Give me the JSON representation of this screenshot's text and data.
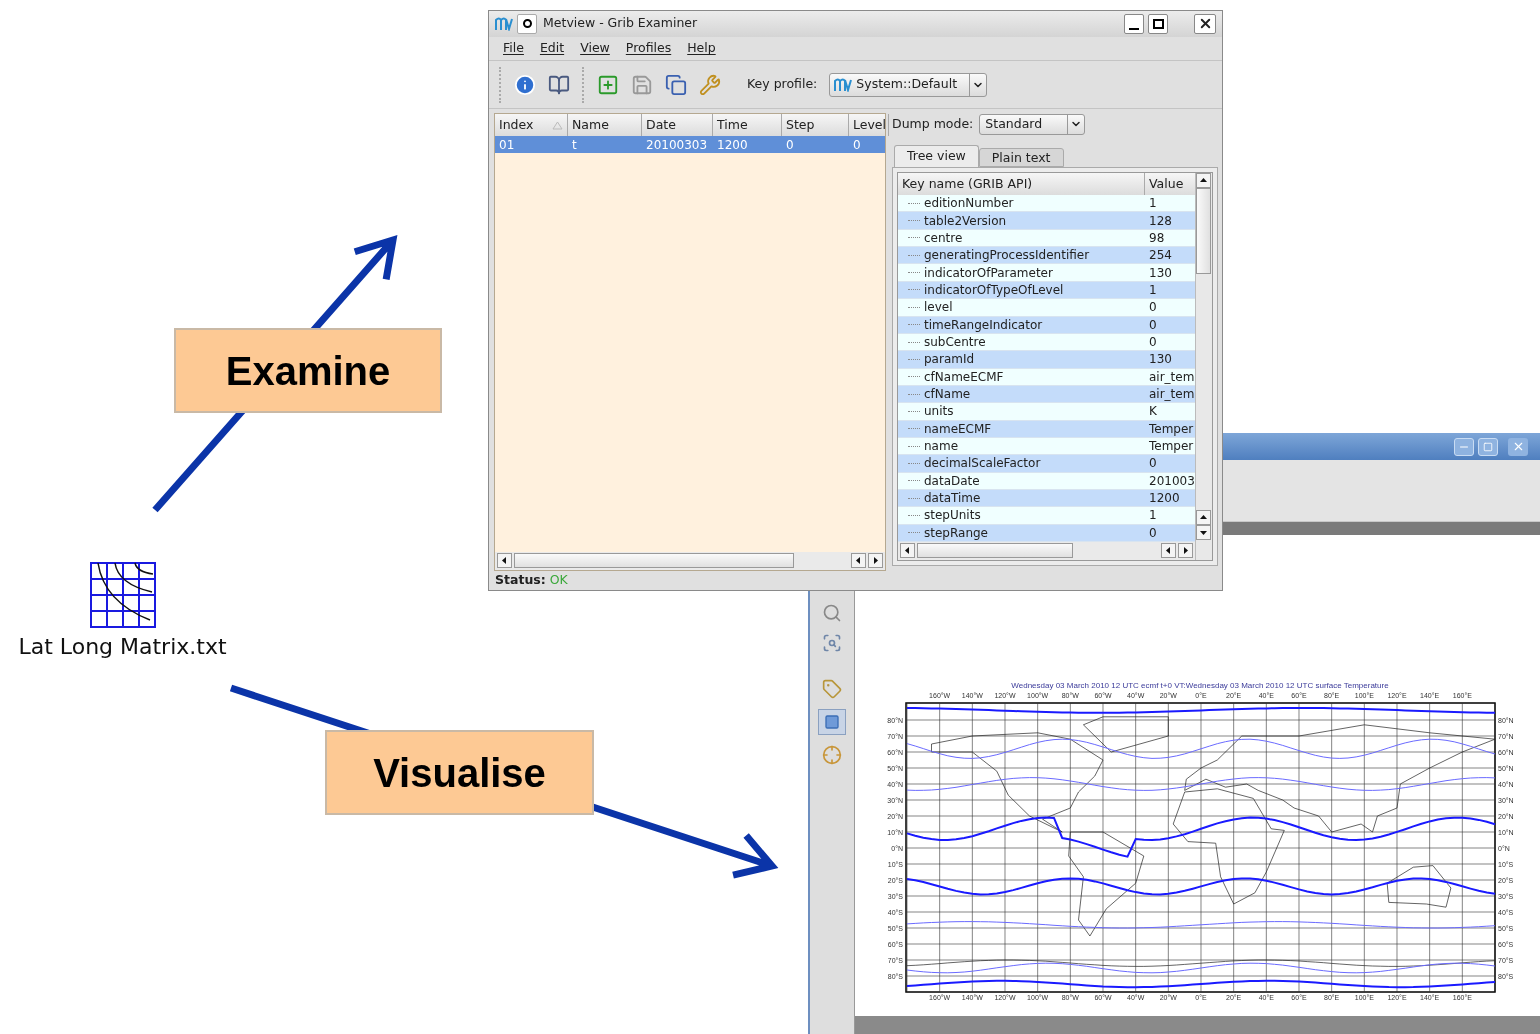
{
  "slide": {
    "labels": [
      {
        "text": "Examine"
      },
      {
        "text": "Visualise"
      }
    ],
    "file_icon": {
      "label": "Lat Long Matrix.txt"
    }
  },
  "grib_window": {
    "title": "Metview - Grib Examiner",
    "menu": [
      "File",
      "Edit",
      "View",
      "Profiles",
      "Help"
    ],
    "key_profile": {
      "label": "Key profile:",
      "value": "System::Default"
    },
    "messages_table": {
      "columns": [
        {
          "label": "Index",
          "sorted": true
        },
        {
          "label": "Name",
          "sorted": false
        },
        {
          "label": "Date",
          "sorted": false
        },
        {
          "label": "Time",
          "sorted": false
        },
        {
          "label": "Step",
          "sorted": false
        },
        {
          "label": "Level",
          "sorted": false
        }
      ],
      "rows": [
        {
          "cells": [
            "01",
            "t",
            "20100303",
            "1200",
            "0",
            "0"
          ],
          "selected": true
        }
      ]
    },
    "dump_mode": {
      "label": "Dump mode:",
      "value": "Standard"
    },
    "tabs": [
      {
        "label": "Tree view",
        "selected": true
      },
      {
        "label": "Plain text",
        "selected": false
      }
    ],
    "tree": {
      "columns": [
        "Key name (GRIB API)",
        "Value"
      ],
      "rows": [
        {
          "key": "editionNumber",
          "value": "1"
        },
        {
          "key": "table2Version",
          "value": "128"
        },
        {
          "key": "centre",
          "value": "98"
        },
        {
          "key": "generatingProcessIdentifier",
          "value": "254"
        },
        {
          "key": "indicatorOfParameter",
          "value": "130"
        },
        {
          "key": "indicatorOfTypeOfLevel",
          "value": "1"
        },
        {
          "key": "level",
          "value": "0"
        },
        {
          "key": "timeRangeIndicator",
          "value": "0"
        },
        {
          "key": "subCentre",
          "value": "0"
        },
        {
          "key": "paramId",
          "value": "130"
        },
        {
          "key": "cfNameECMF",
          "value": "air_tem"
        },
        {
          "key": "cfName",
          "value": "air_tem"
        },
        {
          "key": "units",
          "value": "K"
        },
        {
          "key": "nameECMF",
          "value": "Temper"
        },
        {
          "key": "name",
          "value": "Temper"
        },
        {
          "key": "decimalScaleFactor",
          "value": "0"
        },
        {
          "key": "dataDate",
          "value": "201003"
        },
        {
          "key": "dataTime",
          "value": "1200"
        },
        {
          "key": "stepUnits",
          "value": "1"
        },
        {
          "key": "stepRange",
          "value": "0"
        }
      ]
    },
    "status": {
      "label": "Status:",
      "value": "OK"
    }
  },
  "plot_window": {
    "map": {
      "title": "Wednesday 03 March 2010 12 UTC ecmf t+0 VT:Wednesday 03 March 2010 12 UTC surface  Temperature",
      "longitude_labels_top": [
        "160°W",
        "140°W",
        "120°W",
        "100°W",
        "80°W",
        "60°W",
        "40°W",
        "20°W",
        "0°E",
        "20°E",
        "40°E",
        "60°E",
        "80°E",
        "100°E",
        "120°E",
        "140°E",
        "160°E"
      ],
      "longitude_labels_bottom": [
        "160°W",
        "140°W",
        "120°W",
        "100°W",
        "80°W",
        "60°W",
        "40°W",
        "20°W",
        "0°E",
        "20°E",
        "40°E",
        "60°E",
        "80°E",
        "100°E",
        "120°E",
        "140°E",
        "160°E"
      ],
      "latitude_labels_left": [
        "80°N",
        "70°N",
        "60°N",
        "50°N",
        "40°N",
        "30°N",
        "20°N",
        "10°N",
        "0°N",
        "10°S",
        "20°S",
        "30°S",
        "40°S",
        "50°S",
        "60°S",
        "70°S",
        "80°S"
      ],
      "latitude_labels_right": [
        "80°N",
        "70°N",
        "60°N",
        "50°N",
        "40°N",
        "30°N",
        "20°N",
        "10°N",
        "0°N",
        "10°S",
        "20°S",
        "30°S",
        "40°S",
        "50°S",
        "60°S",
        "70°S",
        "80°S"
      ]
    }
  }
}
